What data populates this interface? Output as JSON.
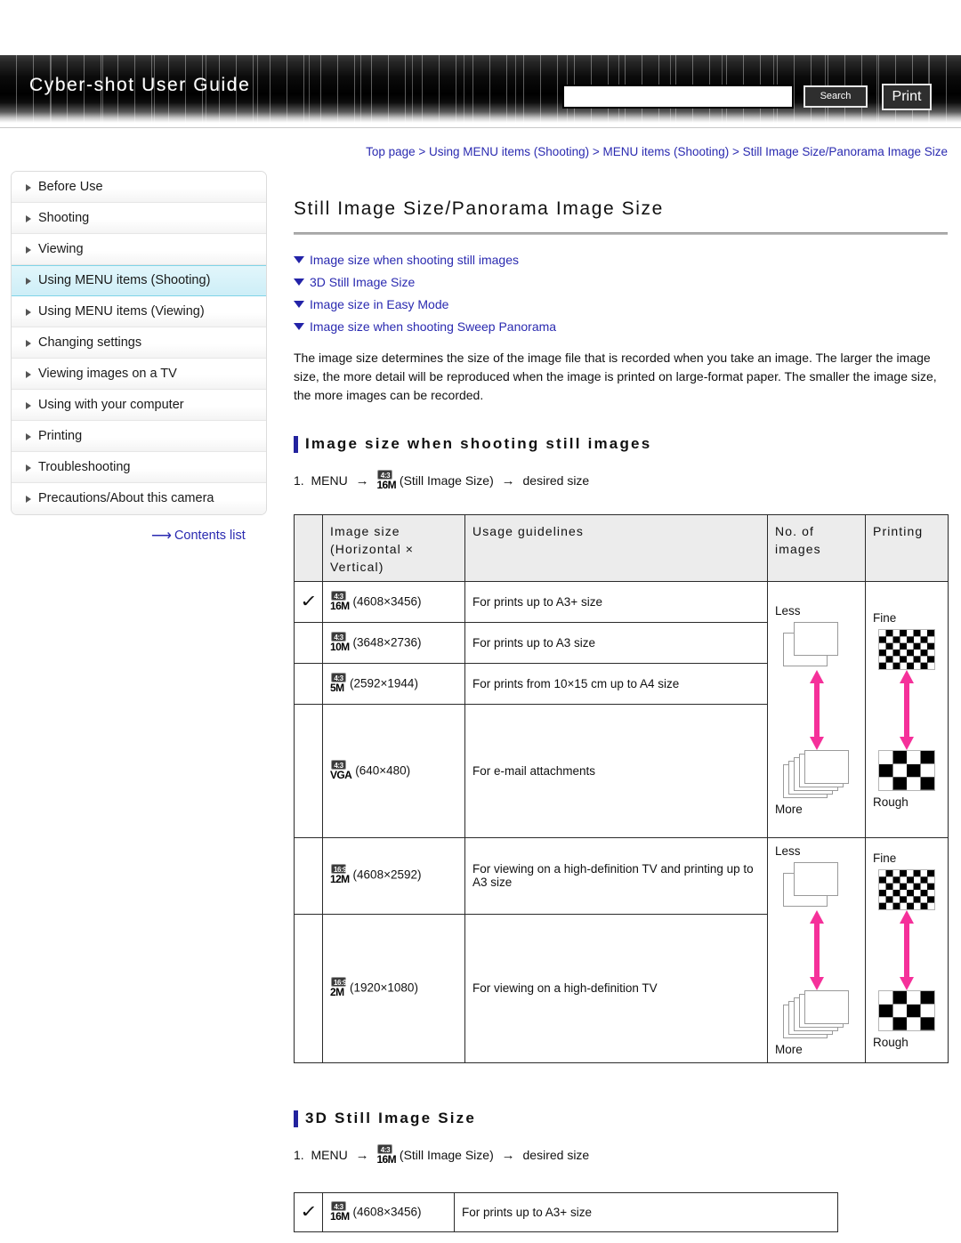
{
  "header": {
    "brand_title": "Cyber-shot User Guide",
    "search_value": "",
    "search_placeholder": "",
    "search_button_label": "Search",
    "print_button_label": "Print"
  },
  "sidebar": {
    "items": [
      {
        "label": "Before Use",
        "active": false
      },
      {
        "label": "Shooting",
        "active": false
      },
      {
        "label": "Viewing",
        "active": false
      },
      {
        "label": "Using MENU items (Shooting)",
        "active": true
      },
      {
        "label": "Using MENU items (Viewing)",
        "active": false
      },
      {
        "label": "Changing settings",
        "active": false
      },
      {
        "label": "Viewing images on a TV",
        "active": false
      },
      {
        "label": "Using with your computer",
        "active": false
      },
      {
        "label": "Printing",
        "active": false
      },
      {
        "label": "Troubleshooting",
        "active": false
      },
      {
        "label": "Precautions/About this camera",
        "active": false
      }
    ],
    "contents_list_label": "Contents list",
    "contents_list_arrow": "⟶"
  },
  "main": {
    "breadcrumb": "Top page > Using MENU items (Shooting) > MENU items (Shooting) > Still Image Size/Panorama Image Size",
    "page_title": "Still Image Size/Panorama Image Size",
    "anchors": [
      "Image size when shooting still images",
      "3D Still Image Size",
      "Image size in Easy Mode",
      "Image size when shooting Sweep Panorama"
    ],
    "intro": "The image size determines the size of the image file that is recorded when you take an image. The larger the image size, the more detail will be reproduced when the image is printed on large-format paper. The smaller the image size, the more images can be recorded.",
    "section1": {
      "heading": "Image size when shooting still images",
      "step_number": "1.",
      "step_menu": "MENU",
      "step_arrow": "→",
      "step_icon_badge": "4:3",
      "step_icon_size": "16M",
      "step_icon_caption": "(Still Image Size)",
      "step_tail": "desired size"
    },
    "section2": {
      "heading": "3D Still Image Size",
      "step_number": "1.",
      "step_menu": "MENU",
      "step_arrow": "→",
      "step_icon_badge": "4:3",
      "step_icon_size": "16M",
      "step_icon_caption": "(Still Image Size)",
      "step_tail": "desired size"
    }
  },
  "table_main": {
    "headers": {
      "check": "",
      "size": "Image size (Horizontal × Vertical)",
      "usage": "Usage guidelines",
      "count": "No. of images",
      "printing": "Printing"
    },
    "rows": [
      {
        "checked": true,
        "badge": "4:3",
        "size": "16M",
        "dims": "(4608×3456)",
        "usage": "For prints up to A3+ size"
      },
      {
        "checked": false,
        "badge": "4:3",
        "size": "10M",
        "dims": "(3648×2736)",
        "usage": "For prints up to A3 size"
      },
      {
        "checked": false,
        "badge": "4:3",
        "size": "5M",
        "dims": "(2592×1944)",
        "usage": "For prints from 10×15 cm up to A4 size"
      },
      {
        "checked": false,
        "badge": "4:3",
        "size": "VGA",
        "dims": "(640×480)",
        "usage": "For e-mail attachments"
      },
      {
        "checked": false,
        "badge": "16:9",
        "size": "12M",
        "dims": "(4608×2592)",
        "usage": "For viewing on a high-definition TV and printing up to A3 size"
      },
      {
        "checked": false,
        "badge": "16:9",
        "size": "2M",
        "dims": "(1920×1080)",
        "usage": "For viewing on a high-definition TV"
      }
    ],
    "meters": {
      "group1": {
        "count_top": "Less",
        "count_bottom": "More",
        "print_top": "Fine",
        "print_bottom": "Rough"
      },
      "group2": {
        "count_top": "Less",
        "count_bottom": "More",
        "print_top": "Fine",
        "print_bottom": "Rough"
      }
    }
  },
  "table_3d": {
    "rows": [
      {
        "checked": true,
        "badge": "4:3",
        "size": "16M",
        "dims": "(4608×3456)",
        "usage": "For prints up to A3+ size"
      }
    ]
  },
  "glyphs": {
    "check": "✓"
  },
  "colors": {
    "link": "#2a2ab0",
    "accent_bar": "#23239e",
    "meter_arrow": "#f5309a",
    "active_nav_bg": "#cdeef7",
    "active_nav_border": "#7fd4e8",
    "table_border": "#2a2a2a",
    "table_header_bg": "#ececec"
  }
}
